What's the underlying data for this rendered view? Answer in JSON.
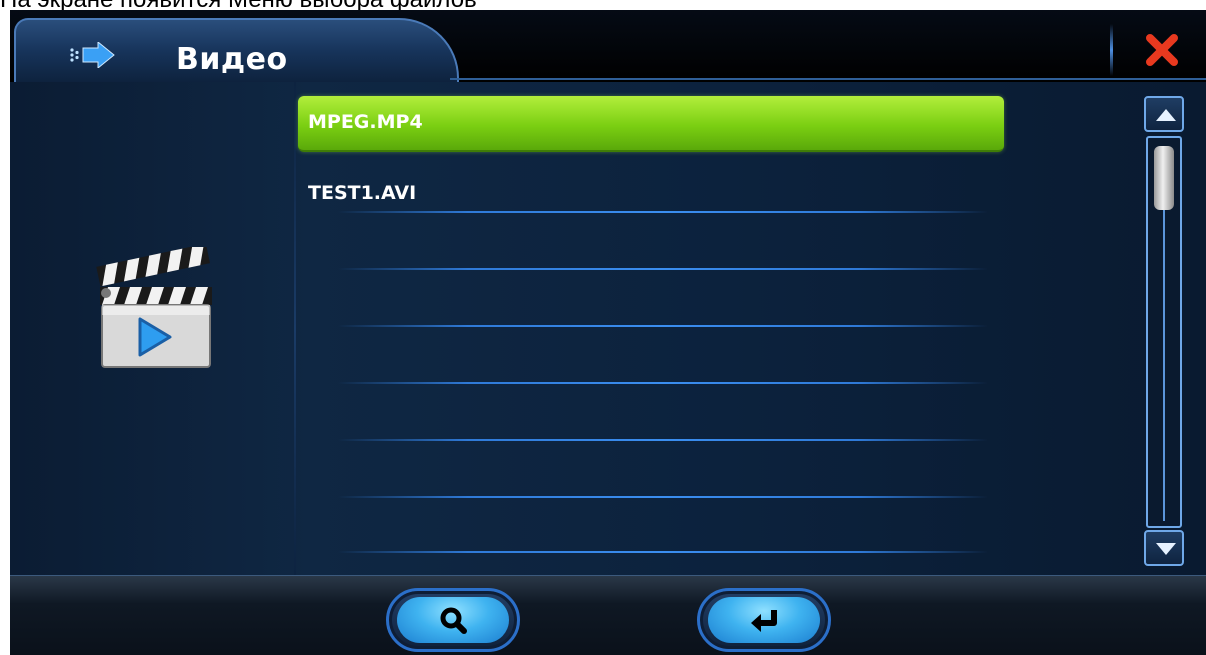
{
  "caption": "На экране появится Меню выбора файлов",
  "header": {
    "title": "Видео",
    "back_icon": "arrow-right-icon",
    "close_icon": "close-icon",
    "close_color": "#e8391f"
  },
  "media_icon": "video-clapperboard-icon",
  "file_list": {
    "items": [
      {
        "label": "MPEG.MP4",
        "selected": true
      },
      {
        "label": "TEST1.AVI",
        "selected": false
      }
    ],
    "selected_color": "#8ad61a"
  },
  "scrollbar": {
    "up_icon": "triangle-up-icon",
    "down_icon": "triangle-down-icon",
    "position": 0
  },
  "bottom": {
    "search_icon": "search-icon",
    "enter_icon": "return-arrow-icon"
  }
}
